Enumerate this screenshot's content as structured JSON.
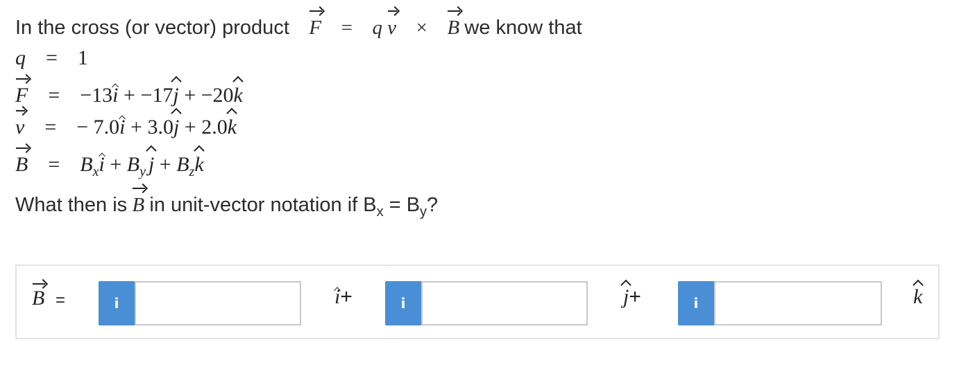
{
  "question": {
    "intro_text": "In the cross (or vector) product",
    "intro_suffix": "we know that",
    "eq_F": "F",
    "eq_equals": "=",
    "eq_q": "q",
    "eq_v": "v",
    "eq_cross": "×",
    "eq_B": "B",
    "q_line": {
      "lhs": "q",
      "eq": "=",
      "value": "1"
    },
    "F_line": {
      "lhs": "F",
      "eq": "=",
      "x": "−13",
      "plus1": "+",
      "y": "−17",
      "plus2": "+",
      "z": "−20"
    },
    "v_line": {
      "lhs": "v",
      "eq": "=",
      "x": "− 7.0",
      "plus1": "+",
      "y": "3.0",
      "plus2": "+",
      "z": "2.0"
    },
    "B_line": {
      "lhs": "B",
      "eq": "=",
      "bx": "B",
      "bx_sub": "x",
      "plus1": "+",
      "by": "B",
      "by_sub": "y",
      "plus2": "+",
      "bz": "B",
      "bz_sub": "z"
    },
    "unit_i": "i",
    "unit_j": "j",
    "unit_k": "k",
    "prompt_before": "What then is",
    "prompt_B": "B",
    "prompt_after": "in unit-vector notation if B",
    "prompt_sub_x": "x",
    "prompt_eq": " = B",
    "prompt_sub_y": "y",
    "prompt_end": "?"
  },
  "answer": {
    "lhs": "B",
    "eq": "=",
    "info_icon": "i",
    "unit_i": "i",
    "unit_j": "j",
    "unit_k": "k",
    "plus": "+",
    "field_x_value": "",
    "field_y_value": "",
    "field_z_value": ""
  },
  "colors": {
    "info_button": "#4a8fd6",
    "border": "#e3e3e3",
    "input_border": "#c8c8c8"
  }
}
